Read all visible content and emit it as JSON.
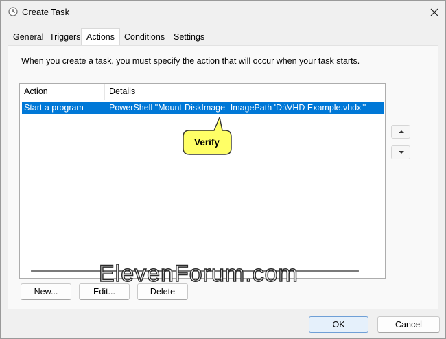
{
  "window": {
    "title": "Create Task"
  },
  "icons": {
    "app": "task-scheduler-clock-icon",
    "close": "close-icon",
    "up": "move-up-arrow-icon",
    "down": "move-down-arrow-icon"
  },
  "tabs": [
    {
      "label": "General",
      "active": false
    },
    {
      "label": "Triggers",
      "active": false
    },
    {
      "label": "Actions",
      "active": true
    },
    {
      "label": "Conditions",
      "active": false
    },
    {
      "label": "Settings",
      "active": false
    }
  ],
  "description": "When you create a task, you must specify the action that will occur when your task starts.",
  "actions_list": {
    "columns": [
      "Action",
      "Details"
    ],
    "rows": [
      {
        "action": "Start a program",
        "details": "PowerShell \"Mount-DiskImage -ImagePath 'D:\\VHD Example.vhdx'\"",
        "selected": true
      }
    ]
  },
  "callout": {
    "label": "Verify",
    "color": "#ffff66"
  },
  "buttons": {
    "new": "New...",
    "edit": "Edit...",
    "delete": "Delete",
    "ok": "OK",
    "cancel": "Cancel"
  },
  "watermark": "ElevenForum.com",
  "colors": {
    "selection": "#0078d7",
    "primary_border": "#6f9fd6"
  }
}
